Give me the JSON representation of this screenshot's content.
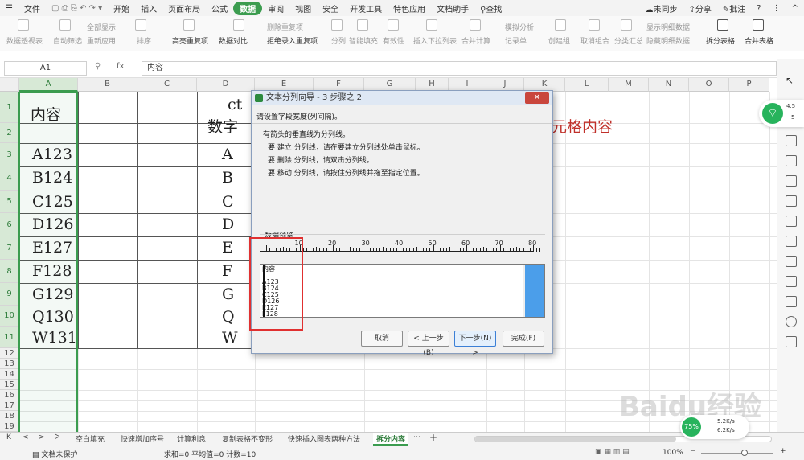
{
  "menu": {
    "file": "文件",
    "tabs": [
      "开始",
      "插入",
      "页面布局",
      "公式",
      "数据",
      "审阅",
      "视图",
      "安全",
      "开发工具",
      "特色应用",
      "文档助手"
    ],
    "active_tab": "数据",
    "search": "查找",
    "sync": "未同步",
    "share": "分享",
    "comment": "批注"
  },
  "ribbon": {
    "pivot": "数据透视表",
    "autofilter": "自动筛选",
    "show_all": "全部显示",
    "reapply": "重新应用",
    "sort": "排序",
    "highlight_dup": "高亮重复项",
    "remove_dup": "删除重复项",
    "data_compare": "数据对比",
    "reject_dup": "拒绝录入重复项",
    "split": "分列",
    "smart_fill": "智能填充",
    "validity": "有效性",
    "dropdown": "插入下拉列表",
    "consolidate": "合并计算",
    "simulate": "模拟分析",
    "record": "记录单",
    "group": "创建组",
    "ungroup": "取消组合",
    "subtotal": "分类汇总",
    "show_detail": "显示明细数据",
    "hide_detail": "隐藏明细数据",
    "split_table": "拆分表格",
    "merge_table": "合并表格"
  },
  "formula_bar": {
    "cell_ref": "A1",
    "fx": "fx",
    "value": "内容"
  },
  "columns": [
    "A",
    "B",
    "C",
    "D",
    "E",
    "F",
    "G",
    "H",
    "I",
    "J",
    "K",
    "L",
    "M",
    "N",
    "O",
    "P"
  ],
  "rows": [
    "1",
    "2",
    "3",
    "4",
    "5",
    "6",
    "7",
    "8",
    "9",
    "10",
    "11",
    "12",
    "13",
    "14",
    "15",
    "16",
    "17",
    "18",
    "19"
  ],
  "cells": {
    "a1": "内容",
    "a_values": [
      "A123",
      "B124",
      "C125",
      "D126",
      "E127",
      "F128",
      "G129",
      "Q130",
      "W131"
    ],
    "d1": "ct",
    "d2": "数字",
    "d_values": [
      "A",
      "B",
      "C",
      "D",
      "E",
      "F",
      "G",
      "Q",
      "W"
    ],
    "overflow_text": "元格内容"
  },
  "dialog": {
    "title": "文本分列向导 - 3 步骤之 2",
    "instruction": "请设置字段宽度(列间隔)。",
    "hint": "有箭头的垂直线为分列线。",
    "step1": "要 建立 分列线，请在要建立分列线处单击鼠标。",
    "step2": "要 删除 分列线，请双击分列线。",
    "step3": "要 移动 分列线，请按住分列线并拖至指定位置。",
    "preview_label": "数据预览",
    "ruler": [
      "10",
      "20",
      "30",
      "40",
      "50",
      "60",
      "70",
      "80"
    ],
    "preview_lines": [
      "内容",
      "",
      "A123",
      "B124",
      "C125",
      "D126",
      "E127",
      "F128"
    ],
    "cancel": "取消",
    "back": "< 上一步(B)",
    "next": "下一步(N) >",
    "finish": "完成(F)",
    "close": "✕"
  },
  "sheet_tabs": [
    "空白填充",
    "快速增加序号",
    "计算利息",
    "复制表格不变形",
    "快速插入图表两种方法",
    "拆分内容"
  ],
  "active_sheet": "拆分内容",
  "status": {
    "protect": "文档未保护",
    "summary": "求和=0  平均值=0  计数=10",
    "zoom": "100%"
  },
  "overlay": {
    "wifi_speed": "4.5",
    "wifi_count": "5",
    "pct": "75%",
    "up": "5.2K/s",
    "down": "6.2K/s",
    "watermark": "Baidu经验"
  }
}
